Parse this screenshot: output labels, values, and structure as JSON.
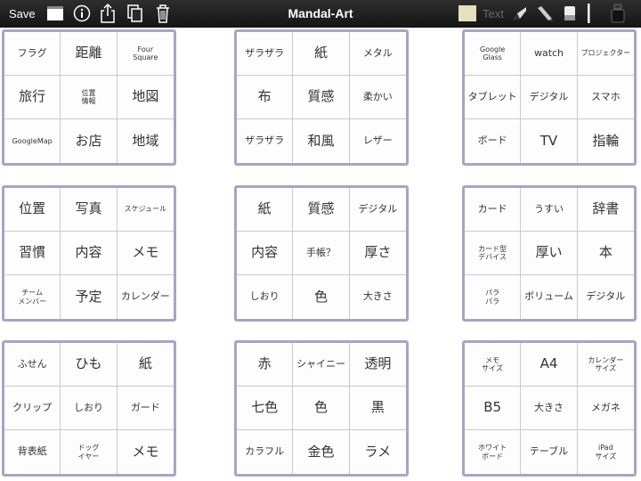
{
  "toolbar": {
    "save_label": "Save",
    "title": "Mandal-Art",
    "text_tool_label": "Text",
    "icons": [
      "layout-icon",
      "info-icon",
      "share-icon",
      "copy-icon",
      "trash-icon",
      "sticky-note-icon",
      "pen-icon",
      "marker-icon",
      "eraser-icon",
      "ink-bottle-icon"
    ]
  },
  "grids": [
    {
      "cells": [
        "フラグ",
        "距離",
        "Four\nSquare",
        "旅行",
        "位置\n情報",
        "地図",
        "GoogleMap",
        "お店",
        "地域"
      ]
    },
    {
      "cells": [
        "ザラザラ",
        "紙",
        "メタル",
        "布",
        "質感",
        "柔かい",
        "ザラザラ",
        "和風",
        "レザー"
      ]
    },
    {
      "cells": [
        "Google\nGlass",
        "watch",
        "プロジェクター",
        "タブレット",
        "デジタル",
        "スマホ",
        "ボード",
        "TV",
        "指輪"
      ]
    },
    {
      "cells": [
        "位置",
        "写真",
        "スケジュール",
        "習慣",
        "内容",
        "メモ",
        "チーム\nメンバー",
        "予定",
        "カレンダー"
      ]
    },
    {
      "cells": [
        "紙",
        "質感",
        "デジタル",
        "内容",
        "手帳？",
        "厚さ",
        "しおり",
        "色",
        "大きさ"
      ]
    },
    {
      "cells": [
        "カード",
        "うすい",
        "辞書",
        "カード型\nデバイス",
        "厚い",
        "本",
        "パラ\nパラ",
        "ボリューム",
        "デジタル"
      ]
    },
    {
      "cells": [
        "ふせん",
        "ひも",
        "紙",
        "クリップ",
        "しおり",
        "ガード",
        "背表紙",
        "ドッグ\nイヤー",
        "メモ"
      ]
    },
    {
      "cells": [
        "赤",
        "シャイニー",
        "透明",
        "七色",
        "色",
        "黒",
        "カラフル",
        "金色",
        "ラメ"
      ]
    },
    {
      "cells": [
        "メモ\nサイズ",
        "A4",
        "カレンダー\nサイズ",
        "B5",
        "大きさ",
        "メガネ",
        "ホワイト\nボード",
        "テーブル",
        "iPad\nサイズ"
      ]
    }
  ]
}
